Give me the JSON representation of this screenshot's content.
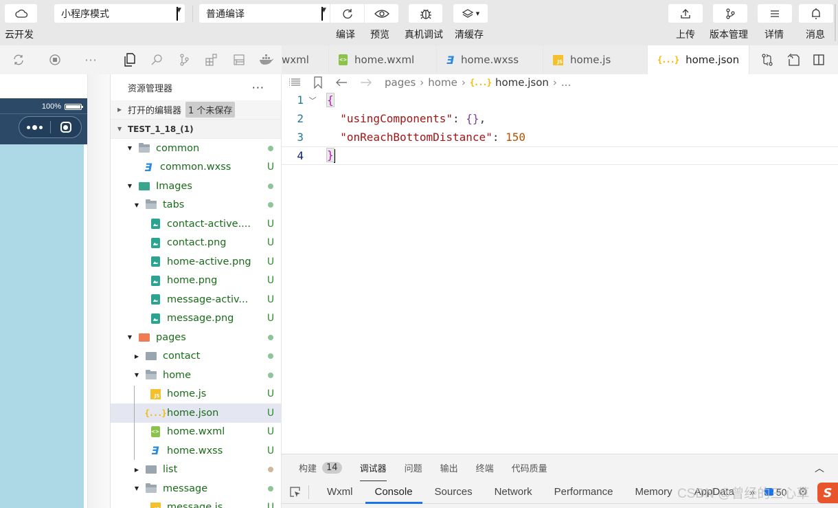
{
  "toolbar": {
    "left_buttons": [
      {
        "icon": "cloud-icon",
        "label": "云开发"
      }
    ],
    "mode_select": {
      "value": "小程序模式"
    },
    "compile_select": {
      "value": "普通编译"
    },
    "center_buttons": [
      {
        "icon": "refresh-icon",
        "label": "编译"
      },
      {
        "icon": "eye-icon",
        "label": "预览"
      },
      {
        "icon": "bug-icon",
        "label": "真机调试"
      },
      {
        "icon": "layers-icon",
        "label": "清缓存"
      }
    ],
    "right_buttons": [
      {
        "icon": "upload-icon",
        "label": "上传"
      },
      {
        "icon": "branch-icon",
        "label": "版本管理"
      },
      {
        "icon": "menu-icon",
        "label": "详情"
      },
      {
        "icon": "bell-icon",
        "label": "消息"
      }
    ]
  },
  "simulator": {
    "battery_pct": "100%",
    "toolbar_icons": [
      "refresh-icon",
      "stop-icon",
      "more-icon"
    ]
  },
  "explorer": {
    "title": "资源管理器",
    "more": "···",
    "open_editors": {
      "label": "打开的编辑器",
      "badge": "1 个未保存"
    },
    "project": {
      "label": "TEST_1_18_(1)"
    },
    "tree": [
      {
        "name": "common",
        "type": "folder-open",
        "indent": 1,
        "status": "dot"
      },
      {
        "name": "common.wxss",
        "type": "wxss",
        "indent": 2,
        "status": "U"
      },
      {
        "name": "Images",
        "type": "folder-images",
        "indent": 1,
        "status": "dot"
      },
      {
        "name": "tabs",
        "type": "folder-open",
        "indent": 2,
        "status": "dot"
      },
      {
        "name": "contact-active....",
        "type": "image",
        "indent": 3,
        "status": "U"
      },
      {
        "name": "contact.png",
        "type": "image",
        "indent": 3,
        "status": "U"
      },
      {
        "name": "home-active.png",
        "type": "image",
        "indent": 3,
        "status": "U"
      },
      {
        "name": "home.png",
        "type": "image",
        "indent": 3,
        "status": "U"
      },
      {
        "name": "message-activ...",
        "type": "image",
        "indent": 3,
        "status": "U"
      },
      {
        "name": "message.png",
        "type": "image",
        "indent": 3,
        "status": "U"
      },
      {
        "name": "pages",
        "type": "folder-pages",
        "indent": 1,
        "status": "dot"
      },
      {
        "name": "contact",
        "type": "folder-closed",
        "indent": 2,
        "status": "dot"
      },
      {
        "name": "home",
        "type": "folder-open",
        "indent": 2,
        "status": "dot"
      },
      {
        "name": "home.js",
        "type": "js",
        "indent": 3,
        "status": "U"
      },
      {
        "name": "home.json",
        "type": "json",
        "indent": 3,
        "status": "U",
        "selected": true
      },
      {
        "name": "home.wxml",
        "type": "wxml",
        "indent": 3,
        "status": "U"
      },
      {
        "name": "home.wxss",
        "type": "wxss",
        "indent": 3,
        "status": "U"
      },
      {
        "name": "list",
        "type": "folder-closed",
        "indent": 2,
        "status": "dot-tan"
      },
      {
        "name": "message",
        "type": "folder-open",
        "indent": 2,
        "status": "dot"
      },
      {
        "name": "message.js",
        "type": "js",
        "indent": 3,
        "status": "U"
      }
    ]
  },
  "tabs": [
    {
      "label": "wxml",
      "icon": "",
      "active": false,
      "partial": true
    },
    {
      "label": "home.wxml",
      "icon": "wxml",
      "active": false
    },
    {
      "label": "home.wxss",
      "icon": "wxss",
      "active": false
    },
    {
      "label": "home.js",
      "icon": "js",
      "active": false
    },
    {
      "label": "home.json",
      "icon": "json",
      "active": true,
      "modified": true
    }
  ],
  "breadcrumb": {
    "items": [
      "pages",
      "home",
      "home.json",
      "..."
    ]
  },
  "editor": {
    "lines": [
      {
        "num": "1",
        "text": "{"
      },
      {
        "num": "2",
        "key": "\"usingComponents\"",
        "value": "{}"
      },
      {
        "num": "3",
        "key": "\"onReachBottomDistance\"",
        "value": "150"
      },
      {
        "num": "4",
        "text": "}"
      }
    ]
  },
  "panel": {
    "top_tabs": [
      {
        "label": "构建",
        "count": "14"
      },
      {
        "label": "调试器",
        "active": true
      },
      {
        "label": "问题"
      },
      {
        "label": "输出"
      },
      {
        "label": "终端"
      },
      {
        "label": "代码质量"
      }
    ],
    "devtools_tabs": [
      {
        "label": "Wxml"
      },
      {
        "label": "Console",
        "active": true
      },
      {
        "label": "Sources"
      },
      {
        "label": "Network"
      },
      {
        "label": "Performance"
      },
      {
        "label": "Memory"
      },
      {
        "label": "AppData"
      }
    ],
    "more": "»",
    "message_count": "50"
  },
  "watermark": "CSDN @曾经的三心草"
}
